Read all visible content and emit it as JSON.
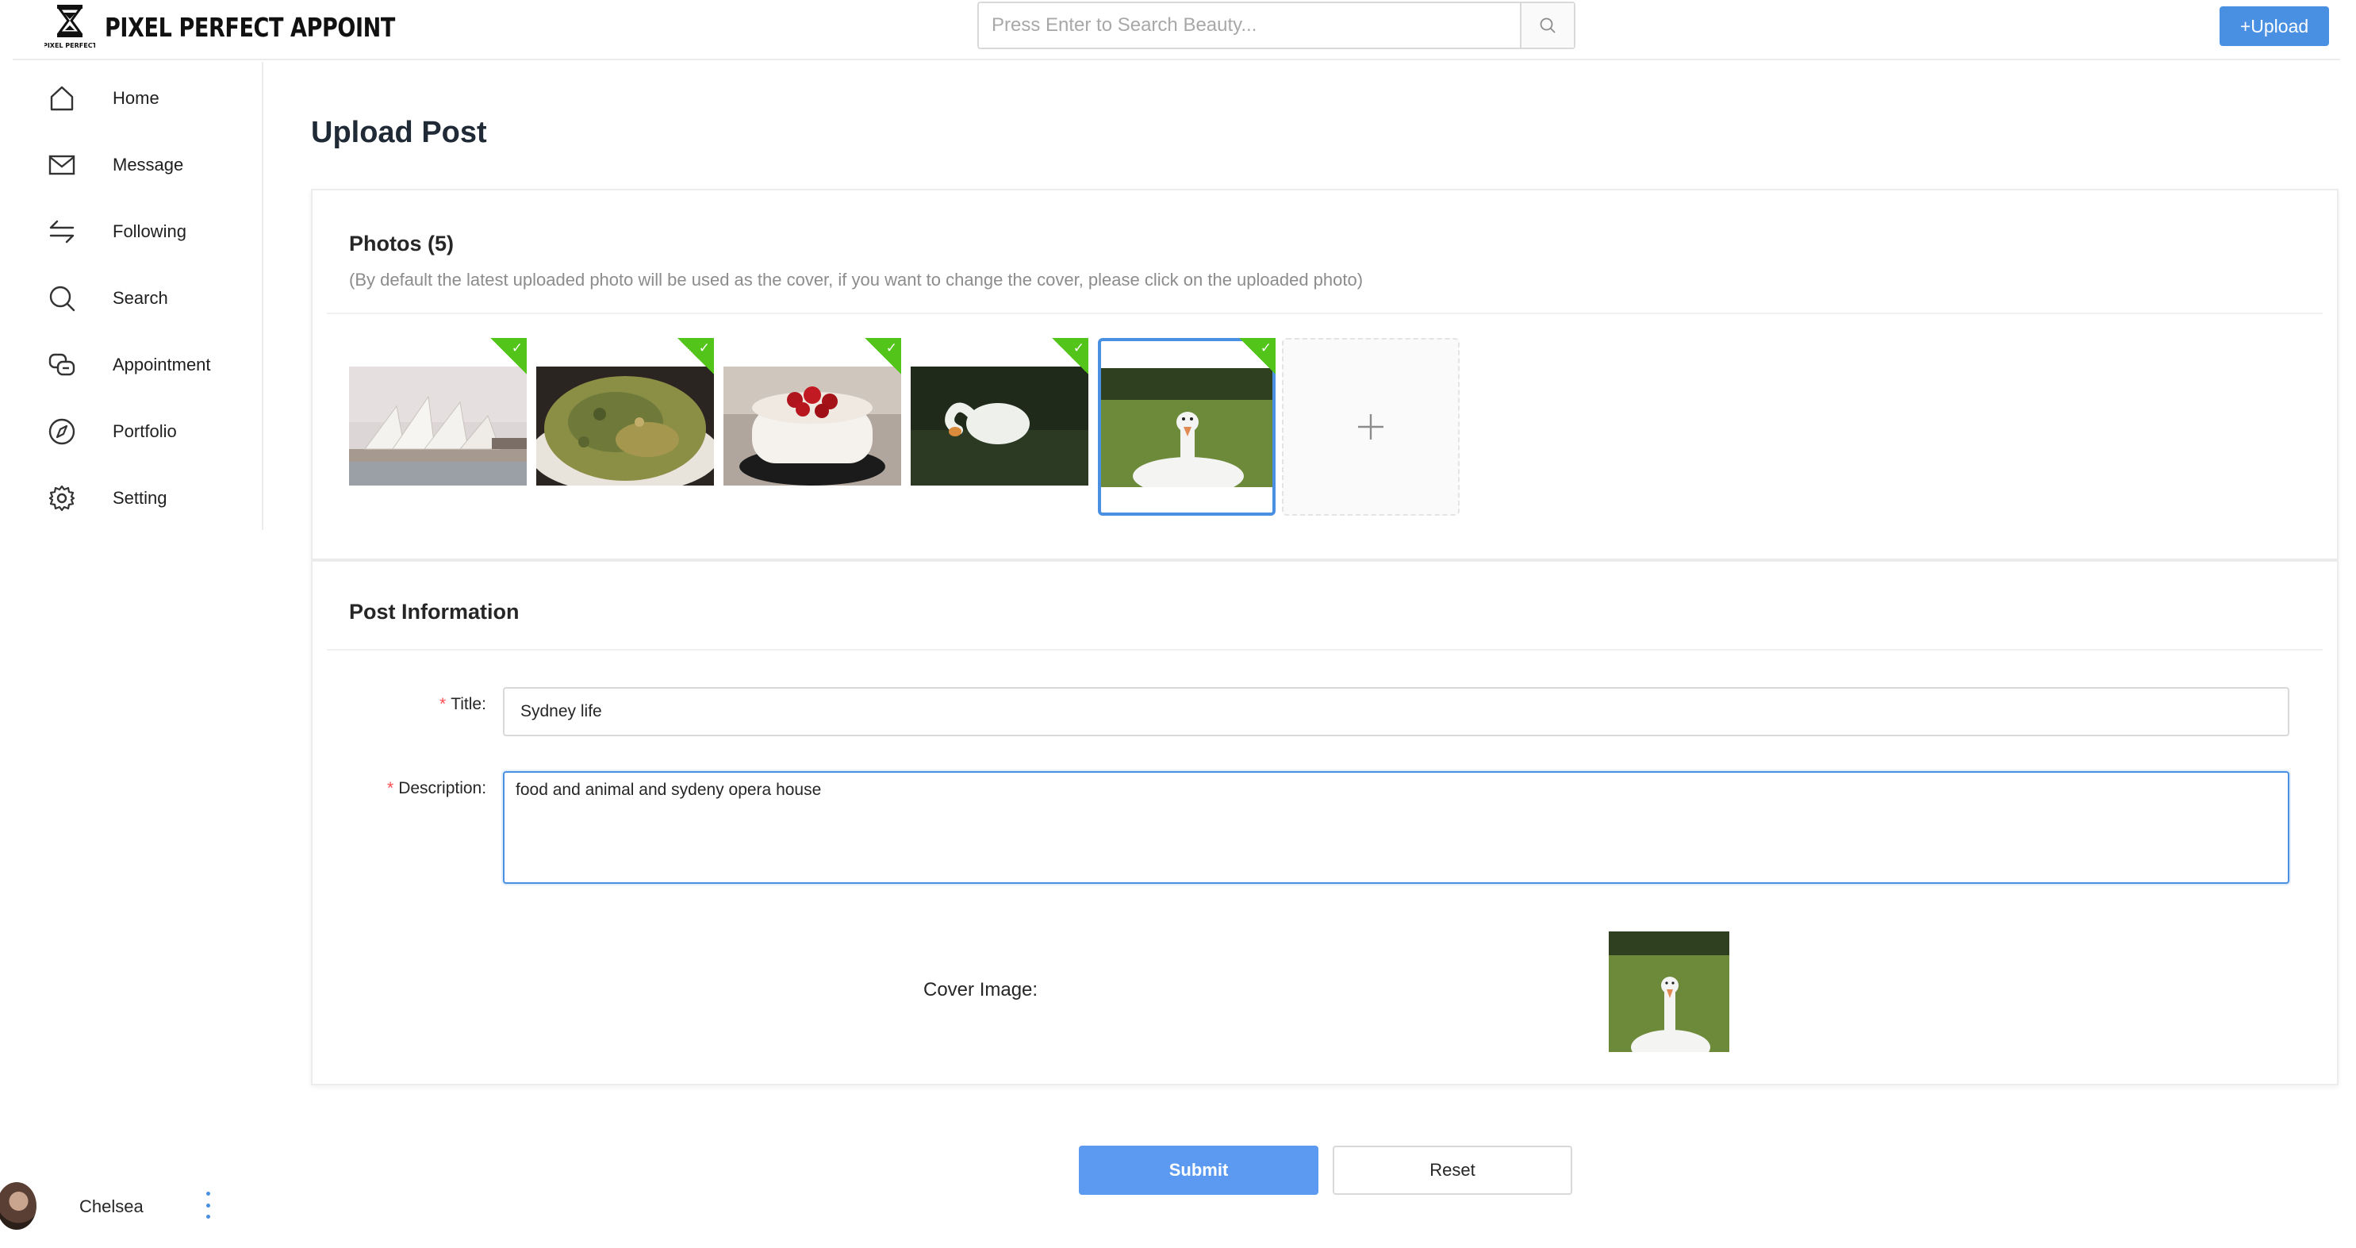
{
  "brand": {
    "name": "PIXEL PERFECT APPOINT",
    "logo_icon": "hourglass-logo-icon"
  },
  "search": {
    "placeholder": "Press Enter to Search Beauty...",
    "icon": "search-icon"
  },
  "header": {
    "upload_label": "+Upload"
  },
  "sidebar": {
    "items": [
      {
        "label": "Home",
        "icon": "home-icon"
      },
      {
        "label": "Message",
        "icon": "mail-icon"
      },
      {
        "label": "Following",
        "icon": "swap-icon"
      },
      {
        "label": "Search",
        "icon": "search-icon"
      },
      {
        "label": "Appointment",
        "icon": "chat-bubbles-icon"
      },
      {
        "label": "Portfolio",
        "icon": "compass-icon"
      },
      {
        "label": "Setting",
        "icon": "gear-icon"
      }
    ]
  },
  "user": {
    "name": "Chelsea"
  },
  "page": {
    "title": "Upload Post"
  },
  "photos": {
    "title": "Photos (5)",
    "hint": "(By default the latest uploaded photo will be used as the cover, if you want to change the cover, please click on the uploaded photo)",
    "items": [
      {
        "subject": "sydney-opera-house",
        "checked": true,
        "selected": false
      },
      {
        "subject": "pancake-plate",
        "checked": true,
        "selected": false
      },
      {
        "subject": "strawberry-cake",
        "checked": true,
        "selected": false
      },
      {
        "subject": "goose-grazing",
        "checked": true,
        "selected": false
      },
      {
        "subject": "goose-on-grass",
        "checked": true,
        "selected": true
      }
    ],
    "add_icon": "plus-icon",
    "accent": "#52c41a",
    "selected_color": "#4a90e2"
  },
  "post_info": {
    "title": "Post Information",
    "title_field": {
      "label": "Title:",
      "required_mark": "*",
      "value": "Sydney life"
    },
    "description_field": {
      "label": "Description:",
      "required_mark": "*",
      "value": "food and animal and sydeny opera house"
    },
    "cover_label": "Cover Image:"
  },
  "actions": {
    "submit_label": "Submit",
    "reset_label": "Reset"
  },
  "colors": {
    "primary": "#4a90e2",
    "success": "#52c41a",
    "required": "#ff4d4f"
  }
}
